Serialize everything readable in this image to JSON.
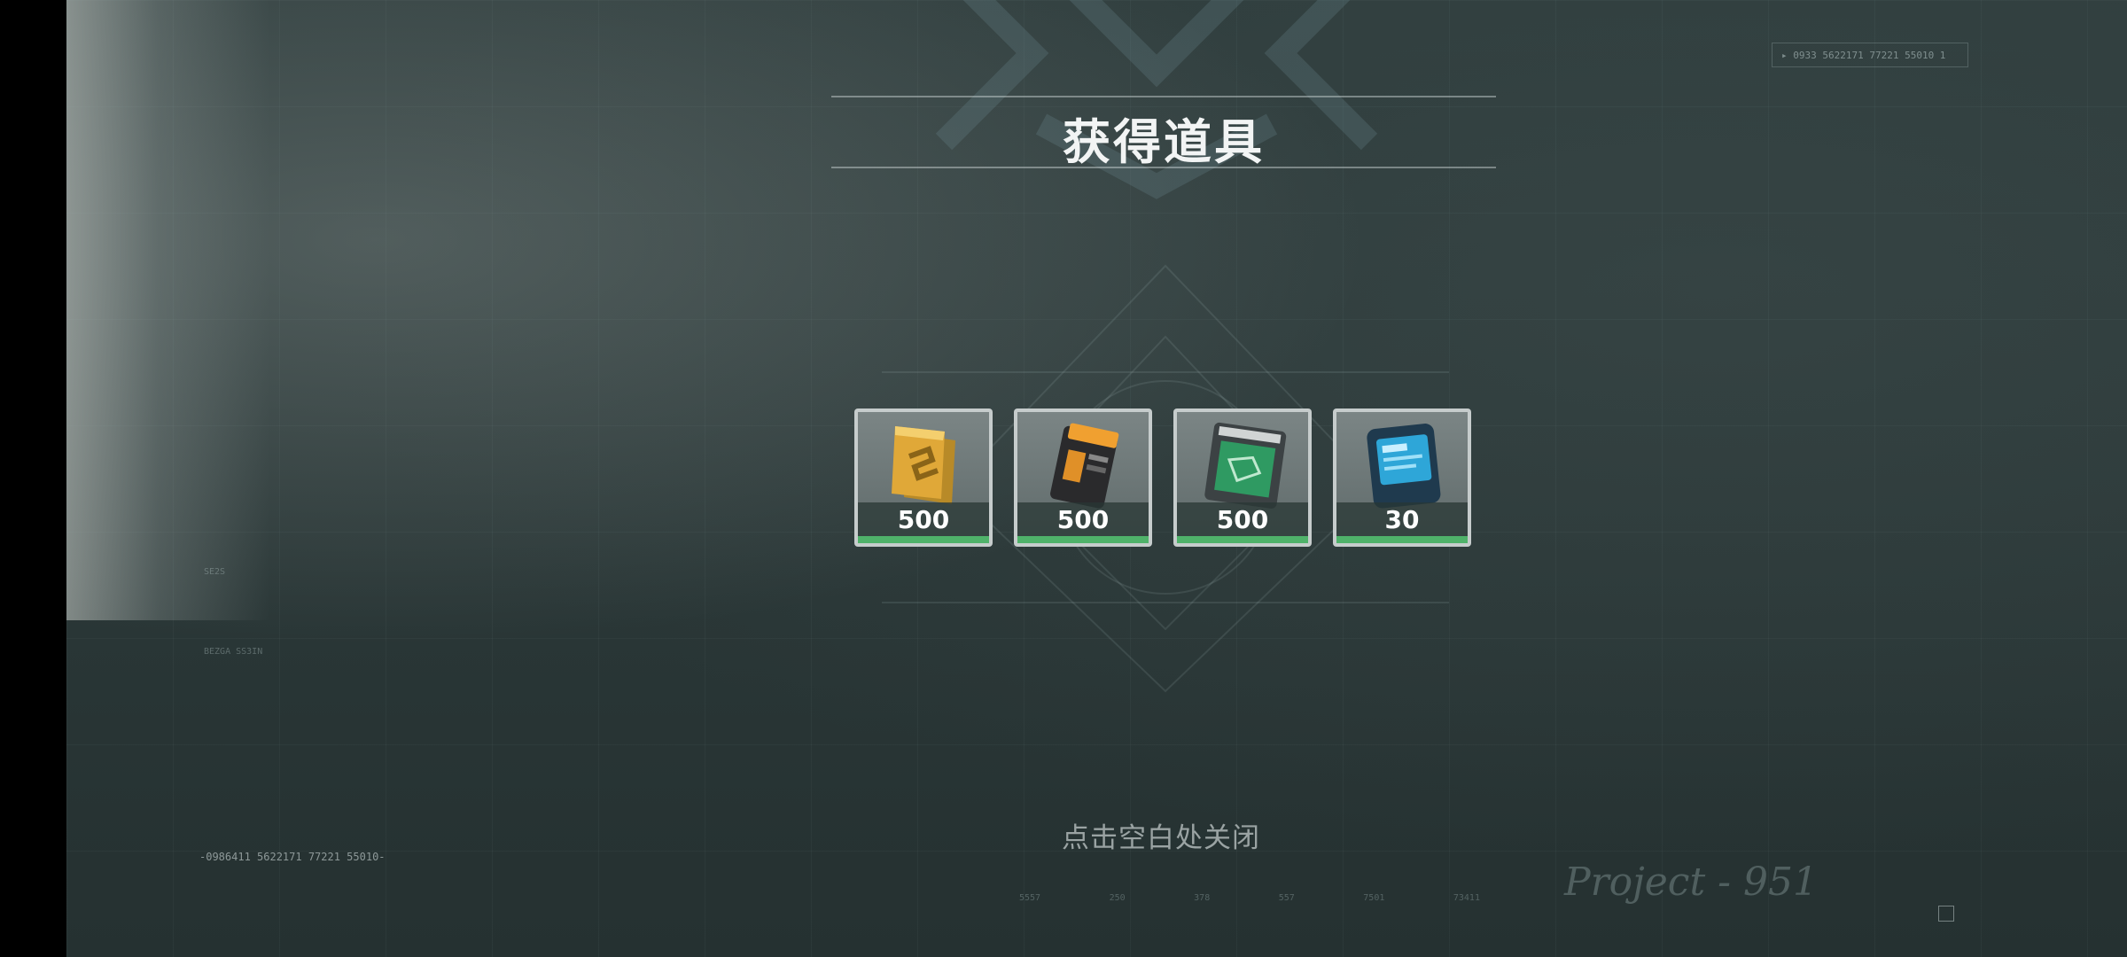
{
  "popup": {
    "title": "获得道具",
    "close_hint": "点击空白处关闭"
  },
  "items": [
    {
      "icon": "gold-credit-bars-icon",
      "count": "500",
      "rarity_color": "#4fb26a"
    },
    {
      "icon": "orange-data-card-icon",
      "count": "500",
      "rarity_color": "#4fb26a"
    },
    {
      "icon": "green-blueprint-cartridge-icon",
      "count": "500",
      "rarity_color": "#4fb26a"
    },
    {
      "icon": "blue-exia-module-icon",
      "count": "30",
      "rarity_color": "#4fb26a"
    }
  ],
  "background": {
    "top_code": "▸ 0933  5622171  77221  55010  1",
    "left_code": "-0986411  5622171  77221  55010-",
    "signature": "Project - 951",
    "bottom_numbers": [
      "5557",
      "250",
      "378",
      "557",
      "7501",
      "73411"
    ]
  },
  "colors": {
    "background": "#2e3c3c",
    "title": "#f2f4f4",
    "rarity_green": "#4fb26a",
    "hint": "#9aa3a3"
  }
}
